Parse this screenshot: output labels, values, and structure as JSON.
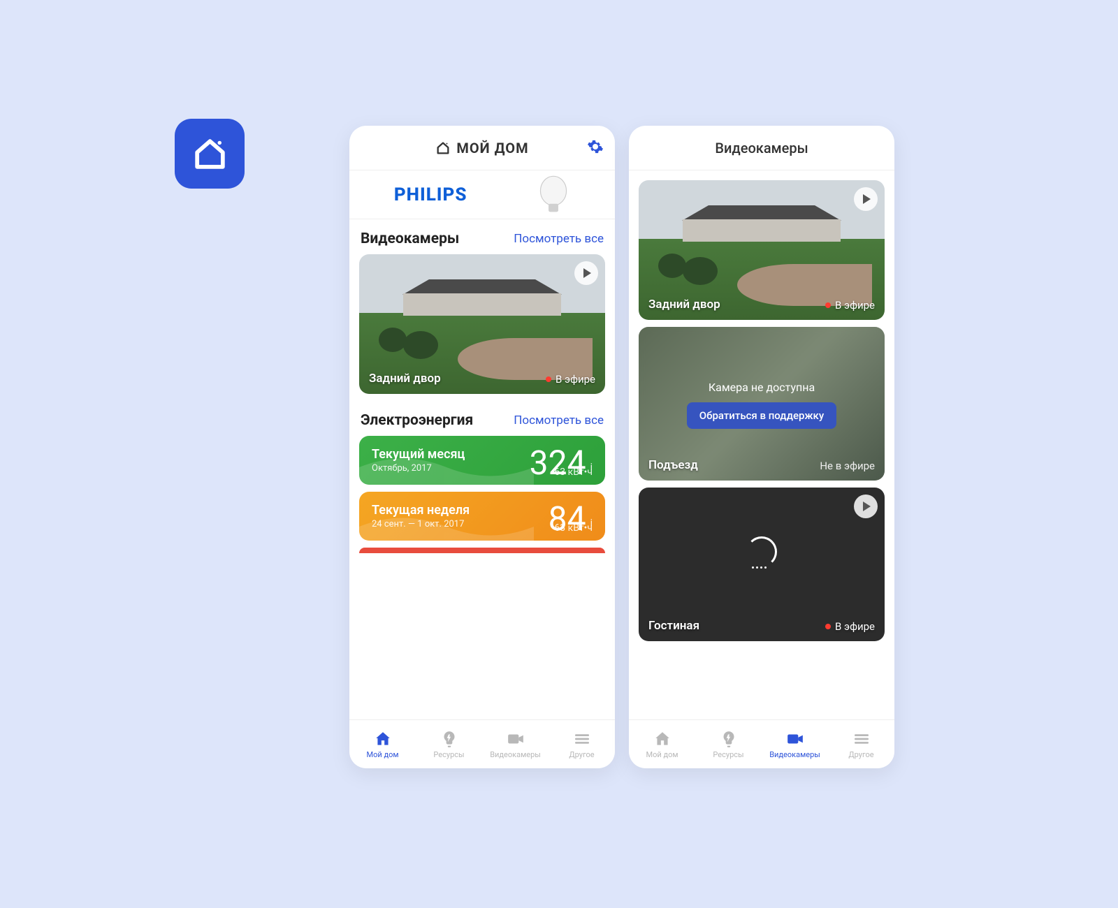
{
  "header1": {
    "title": "МОЙ ДОМ"
  },
  "header2": {
    "title": "Видеокамеры"
  },
  "promo": {
    "brand": "PHILIPS"
  },
  "sections": {
    "cameras": {
      "title": "Видеокамеры",
      "link": "Посмотреть все"
    },
    "energy": {
      "title": "Электроэнергия",
      "link": "Посмотреть все"
    }
  },
  "camera1": {
    "name": "Задний двор",
    "status": "В эфире"
  },
  "camera2": {
    "name": "Подъезд",
    "status": "Не в эфире",
    "error": "Камера не доступна",
    "action": "Обратиться в поддержку"
  },
  "camera3": {
    "name": "Гостиная",
    "status": "В эфире"
  },
  "energy": {
    "month": {
      "label": "Текущий месяц",
      "date": "Октябрь, 2017",
      "value": "324",
      "suffix": "i",
      "unit": "63 кВт•ч"
    },
    "week": {
      "label": "Текущая неделя",
      "date": "24 сент. — 1 окт. 2017",
      "value": "84",
      "suffix": "i",
      "unit": "63 кВт•ч"
    }
  },
  "tabs": {
    "home": "Мой дом",
    "resources": "Ресурсы",
    "cameras": "Видеокамеры",
    "other": "Другое"
  }
}
